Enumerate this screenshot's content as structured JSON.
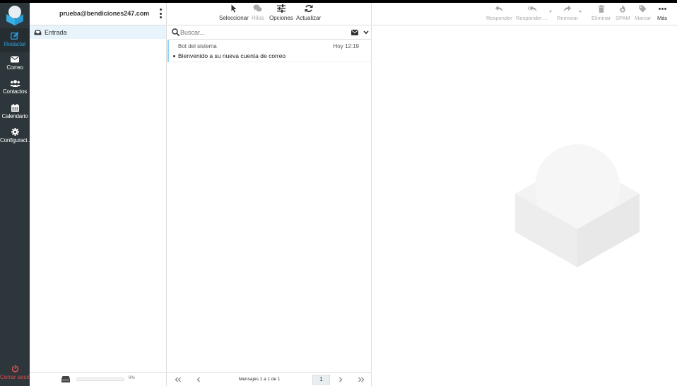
{
  "nav": {
    "items": [
      {
        "label": "Redactar",
        "icon": "compose-icon",
        "active": true
      },
      {
        "label": "Correo",
        "icon": "envelope-icon"
      },
      {
        "label": "Contactos",
        "icon": "users-icon"
      },
      {
        "label": "Calendario",
        "icon": "calendar-icon"
      },
      {
        "label": "Configuraci...",
        "icon": "gear-icon"
      }
    ],
    "logout_label": "Cerrar sesión"
  },
  "folders": {
    "account": "prueba@bendiciones247.com",
    "items": [
      {
        "label": "Entrada",
        "icon": "inbox-icon",
        "selected": true
      }
    ],
    "quota_text": "0%",
    "quota_percent": 0
  },
  "list_toolbar": {
    "select_label": "Seleccionar",
    "threads_label": "Hilos",
    "options_label": "Opciones",
    "refresh_label": "Actualizar"
  },
  "search": {
    "placeholder": "Buscar..."
  },
  "messages": [
    {
      "from": "Bot del sistema",
      "date": "Hoy 12:19",
      "subject": "Bienvenido a su nueva cuenta de correo"
    }
  ],
  "pager": {
    "count_text": "Mensajes 1 a 1 de 1",
    "page": "1"
  },
  "message_toolbar": {
    "reply_label": "Responder",
    "reply_all_label": "Responder ...",
    "forward_label": "Reenviar",
    "delete_label": "Eliminar",
    "spam_label": "SPAM",
    "mark_label": "Marcar",
    "more_label": "Más"
  },
  "colors": {
    "nav_bg": "#2c363b",
    "accent": "#2a9ad3",
    "logout": "#e84d4d",
    "selected_row": "#e8f4fb"
  }
}
